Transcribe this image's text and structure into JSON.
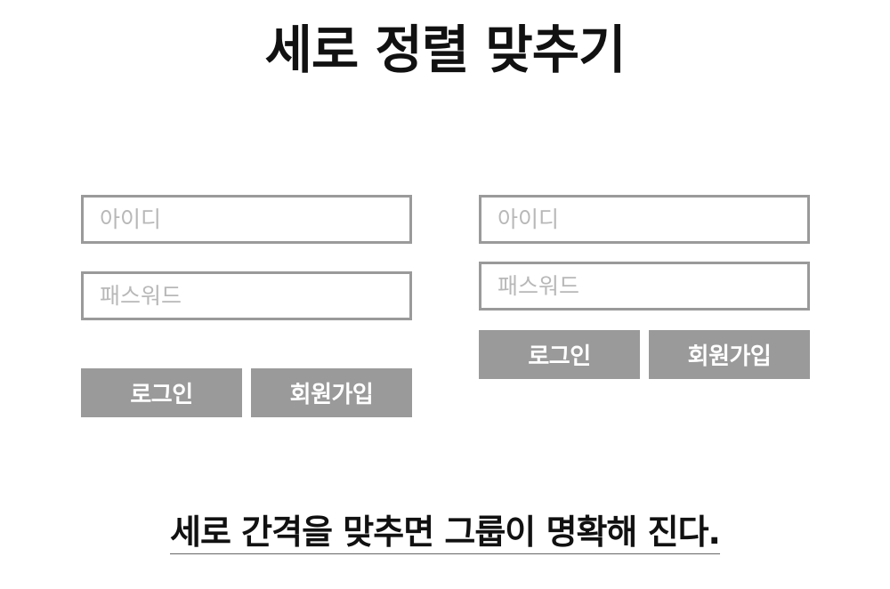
{
  "title": "세로 정렬 맞추기",
  "left_form": {
    "id_placeholder": "아이디",
    "password_placeholder": "패스워드",
    "login_label": "로그인",
    "signup_label": "회원가입"
  },
  "right_form": {
    "id_placeholder": "아이디",
    "password_placeholder": "패스워드",
    "login_label": "로그인",
    "signup_label": "회원가입"
  },
  "caption": "세로 간격을 맞추면 그룹이 명확해 진다.",
  "colors": {
    "border": "#9a9a9a",
    "button_bg": "#9a9a9a",
    "button_text": "#ffffff",
    "placeholder": "#b8b8b8",
    "text": "#111111"
  }
}
